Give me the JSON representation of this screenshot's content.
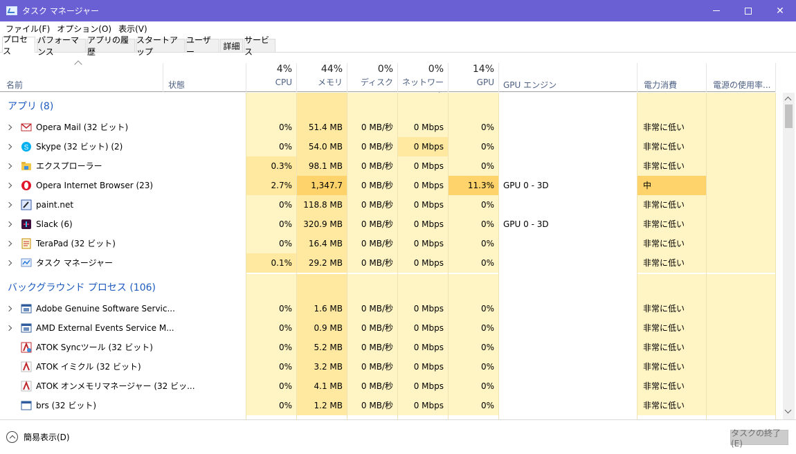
{
  "window": {
    "title": "タスク マネージャー"
  },
  "menu": [
    {
      "label": "ファイル(F)"
    },
    {
      "label": "オプション(O)"
    },
    {
      "label": "表示(V)"
    }
  ],
  "tabs": [
    {
      "label": "プロセス",
      "active": true
    },
    {
      "label": "パフォーマンス"
    },
    {
      "label": "アプリの履歴"
    },
    {
      "label": "スタートアップ"
    },
    {
      "label": "ユーザー"
    },
    {
      "label": "詳細"
    },
    {
      "label": "サービス"
    }
  ],
  "columns": {
    "name": "名前",
    "status": "状態",
    "cpu": {
      "pct": "4%",
      "label": "CPU"
    },
    "memory": {
      "pct": "44%",
      "label": "メモリ"
    },
    "disk": {
      "pct": "0%",
      "label": "ディスク"
    },
    "network": {
      "pct": "0%",
      "label": "ネットワーク"
    },
    "gpu": {
      "pct": "14%",
      "label": "GPU"
    },
    "gpu_engine": "GPU エンジン",
    "power": "電力消費",
    "power_trend": "電源の使用率..."
  },
  "groups": [
    {
      "title": "アプリ (8)",
      "rows": [
        {
          "name": "Opera Mail (32 ビット)",
          "icon": "opera-mail-icon",
          "expand": true,
          "cpu": "0%",
          "mem": "51.4 MB",
          "disk": "0 MB/秒",
          "net": "0 Mbps",
          "gpu": "0%",
          "engine": "",
          "power": "非常に低い"
        },
        {
          "name": "Skype (32 ビット) (2)",
          "icon": "skype-icon",
          "expand": true,
          "cpu": "0%",
          "mem": "54.0 MB",
          "disk": "0 MB/秒",
          "net": "0 Mbps",
          "gpu": "0%",
          "engine": "",
          "power": "非常に低い",
          "net_hl": 2
        },
        {
          "name": "エクスプローラー",
          "icon": "explorer-icon",
          "expand": true,
          "cpu": "0.3%",
          "mem": "98.1 MB",
          "disk": "0 MB/秒",
          "net": "0 Mbps",
          "gpu": "0%",
          "engine": "",
          "power": "非常に低い",
          "cpu_hl": 2
        },
        {
          "name": "Opera Internet Browser (23)",
          "icon": "opera-browser-icon",
          "expand": true,
          "cpu": "2.7%",
          "mem": "1,347.7 MB",
          "disk": "0 MB/秒",
          "net": "0 Mbps",
          "gpu": "11.3%",
          "engine": "GPU 0 - 3D",
          "power": "中",
          "cpu_hl": 2,
          "mem_hl": 3,
          "gpu_hl": 3,
          "power_hl": 3
        },
        {
          "name": "paint.net",
          "icon": "paint-net-icon",
          "expand": true,
          "cpu": "0%",
          "mem": "118.8 MB",
          "disk": "0 MB/秒",
          "net": "0 Mbps",
          "gpu": "0%",
          "engine": "",
          "power": "非常に低い"
        },
        {
          "name": "Slack (6)",
          "icon": "slack-icon",
          "expand": true,
          "cpu": "0%",
          "mem": "320.9 MB",
          "disk": "0 MB/秒",
          "net": "0 Mbps",
          "gpu": "0%",
          "engine": "GPU 0 - 3D",
          "power": "非常に低い"
        },
        {
          "name": "TeraPad (32 ビット)",
          "icon": "terapad-icon",
          "expand": true,
          "cpu": "0%",
          "mem": "16.4 MB",
          "disk": "0 MB/秒",
          "net": "0 Mbps",
          "gpu": "0%",
          "engine": "",
          "power": "非常に低い"
        },
        {
          "name": "タスク マネージャー",
          "icon": "task-manager-icon",
          "expand": true,
          "cpu": "0.1%",
          "mem": "29.2 MB",
          "disk": "0 MB/秒",
          "net": "0 Mbps",
          "gpu": "0%",
          "engine": "",
          "power": "非常に低い",
          "cpu_hl": 2
        }
      ]
    },
    {
      "title": "バックグラウンド プロセス (106)",
      "rows": [
        {
          "name": "Adobe Genuine Software Servic...",
          "icon": "service-window-icon",
          "expand": true,
          "cpu": "0%",
          "mem": "1.6 MB",
          "disk": "0 MB/秒",
          "net": "0 Mbps",
          "gpu": "0%",
          "engine": "",
          "power": "非常に低い"
        },
        {
          "name": "AMD External Events Service M...",
          "icon": "service-window-icon",
          "expand": true,
          "cpu": "0%",
          "mem": "0.9 MB",
          "disk": "0 MB/秒",
          "net": "0 Mbps",
          "gpu": "0%",
          "engine": "",
          "power": "非常に低い"
        },
        {
          "name": "ATOK Syncツール (32 ビット)",
          "icon": "atok-sync-icon",
          "expand": false,
          "cpu": "0%",
          "mem": "5.2 MB",
          "disk": "0 MB/秒",
          "net": "0 Mbps",
          "gpu": "0%",
          "engine": "",
          "power": "非常に低い"
        },
        {
          "name": "ATOK イミクル (32 ビット)",
          "icon": "atok-icon",
          "expand": false,
          "cpu": "0%",
          "mem": "3.2 MB",
          "disk": "0 MB/秒",
          "net": "0 Mbps",
          "gpu": "0%",
          "engine": "",
          "power": "非常に低い"
        },
        {
          "name": "ATOK オンメモリマネージャー (32 ビッ...",
          "icon": "atok-icon",
          "expand": false,
          "cpu": "0%",
          "mem": "4.1 MB",
          "disk": "0 MB/秒",
          "net": "0 Mbps",
          "gpu": "0%",
          "engine": "",
          "power": "非常に低い"
        },
        {
          "name": "brs (32 ビット)",
          "icon": "window-icon",
          "expand": false,
          "cpu": "0%",
          "mem": "1.2 MB",
          "disk": "0 MB/秒",
          "net": "0 Mbps",
          "gpu": "0%",
          "engine": "",
          "power": "非常に低い"
        }
      ]
    }
  ],
  "footer": {
    "fewer_details": "簡易表示(D)",
    "end_task": "タスクの終了(E)"
  },
  "colors": {
    "titlebar": "#6b5fd4",
    "heat_low": "#fff4c4",
    "heat_mid": "#ffe9a0",
    "heat_high": "#ffd36b",
    "group_title": "#1e5bbf"
  }
}
